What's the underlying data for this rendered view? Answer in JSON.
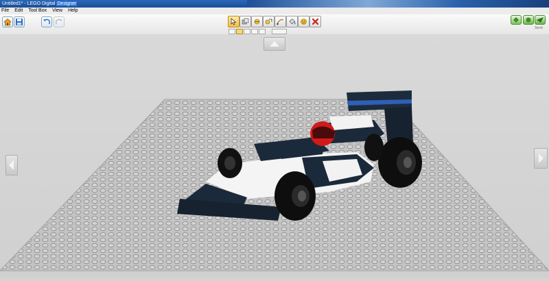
{
  "window": {
    "title_prefix": "Untitled1* - LEGO Digital ",
    "title_highlight": "Designer"
  },
  "menu": [
    "File",
    "Edit",
    "Tool Box",
    "View",
    "Help"
  ],
  "left_toolbar": [
    {
      "icon": "home-icon"
    },
    {
      "icon": "save-icon"
    },
    {
      "icon": "undo-icon"
    },
    {
      "icon": "redo-icon",
      "disabled": true
    }
  ],
  "main_tools": [
    {
      "icon": "select-cursor-icon",
      "active": true
    },
    {
      "icon": "clone-icon"
    },
    {
      "icon": "hinge-icon"
    },
    {
      "icon": "hinge-align-icon"
    },
    {
      "icon": "flex-icon"
    },
    {
      "icon": "paint-bucket-icon"
    },
    {
      "icon": "hide-icon"
    },
    {
      "icon": "delete-icon"
    }
  ],
  "sub_tools": 6,
  "right_toolbar": [
    {
      "icon": "build-mode-icon"
    },
    {
      "icon": "view-mode-icon"
    },
    {
      "icon": "send-icon"
    }
  ],
  "send_label": "Send",
  "colors": {
    "car_body": "#1b2a3a",
    "car_white": "#f4f4f4",
    "car_stripe": "#2f5fb6",
    "helmet": "#d01818",
    "baseplate": "#c2c2c2",
    "stud": "#9a9a9a"
  }
}
